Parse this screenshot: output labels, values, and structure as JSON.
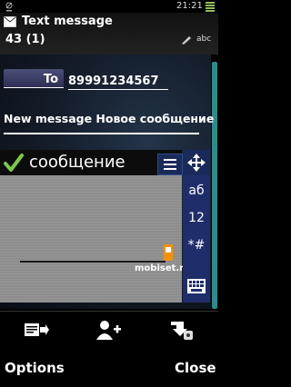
{
  "status_bar": {
    "time": "21:21"
  },
  "header": {
    "title": "Text message",
    "count": "43 (1)",
    "input_mode": "abc"
  },
  "recipient": {
    "to_label": "To",
    "number": "89991234567"
  },
  "message": {
    "text": "New message Новое сообщение"
  },
  "predictive": {
    "word": "сообщение"
  },
  "side_keys": {
    "letters": "аб",
    "numbers": "12",
    "symbols": "*#"
  },
  "watermark": "mobiset.ru",
  "softkeys": {
    "left": "Options",
    "right": "Close"
  },
  "colors": {
    "side_panel": "#1f2e6b",
    "scrollbar": "#2b8c8c",
    "to_button": "#3b3e66"
  }
}
